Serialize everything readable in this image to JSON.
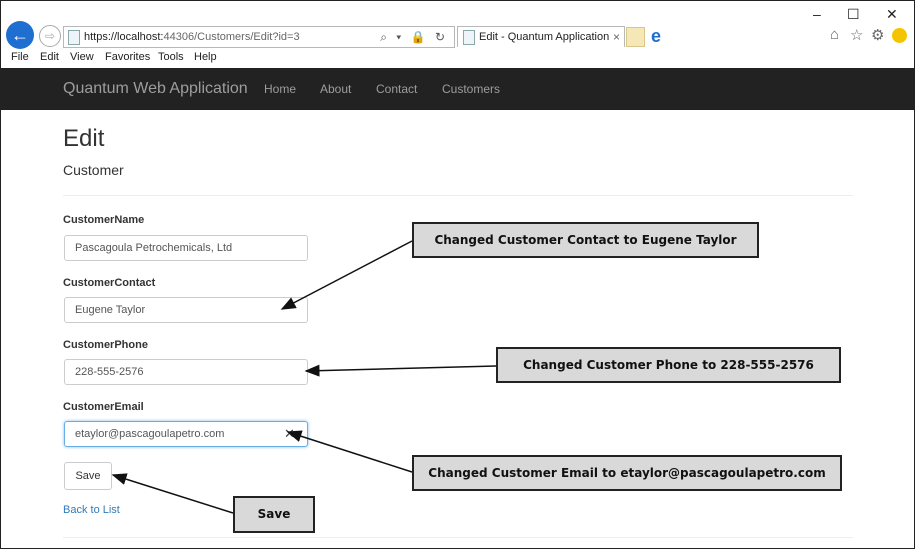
{
  "browser": {
    "url_prefix": "https://localhost:",
    "url_rest": "44306/Customers/Edit?id=3",
    "tab_title": "Edit - Quantum Application",
    "tab_close": "×",
    "back_glyph": "←",
    "forward_glyph": "⇨",
    "address_tools": "⌕ ▾ 🔒 ↻",
    "window_controls": [
      "–",
      "☐",
      "✕"
    ],
    "right_icons": [
      "⌂",
      "☆",
      "⚙"
    ],
    "menu": [
      "File",
      "Edit",
      "View",
      "Favorites",
      "Tools",
      "Help"
    ]
  },
  "navbar": {
    "brand": "Quantum Web Application",
    "links": [
      "Home",
      "About",
      "Contact",
      "Customers"
    ]
  },
  "page": {
    "title": "Edit",
    "subtitle": "Customer"
  },
  "form": {
    "fields": [
      {
        "label": "CustomerName",
        "value": "Pascagoula Petrochemicals, Ltd"
      },
      {
        "label": "CustomerContact",
        "value": "Eugene Taylor"
      },
      {
        "label": "CustomerPhone",
        "value": "228-555-2576"
      },
      {
        "label": "CustomerEmail",
        "value": "etaylor@pascagoulapetro.com"
      }
    ],
    "clear_glyph": "✕",
    "save_label": "Save",
    "back_link": "Back to List"
  },
  "annotations": [
    "Changed Customer Contact to Eugene Taylor",
    "Changed Customer Phone to 228-555-2576",
    "Changed Customer Email to etaylor@pascagoulapetro.com",
    "Save"
  ]
}
